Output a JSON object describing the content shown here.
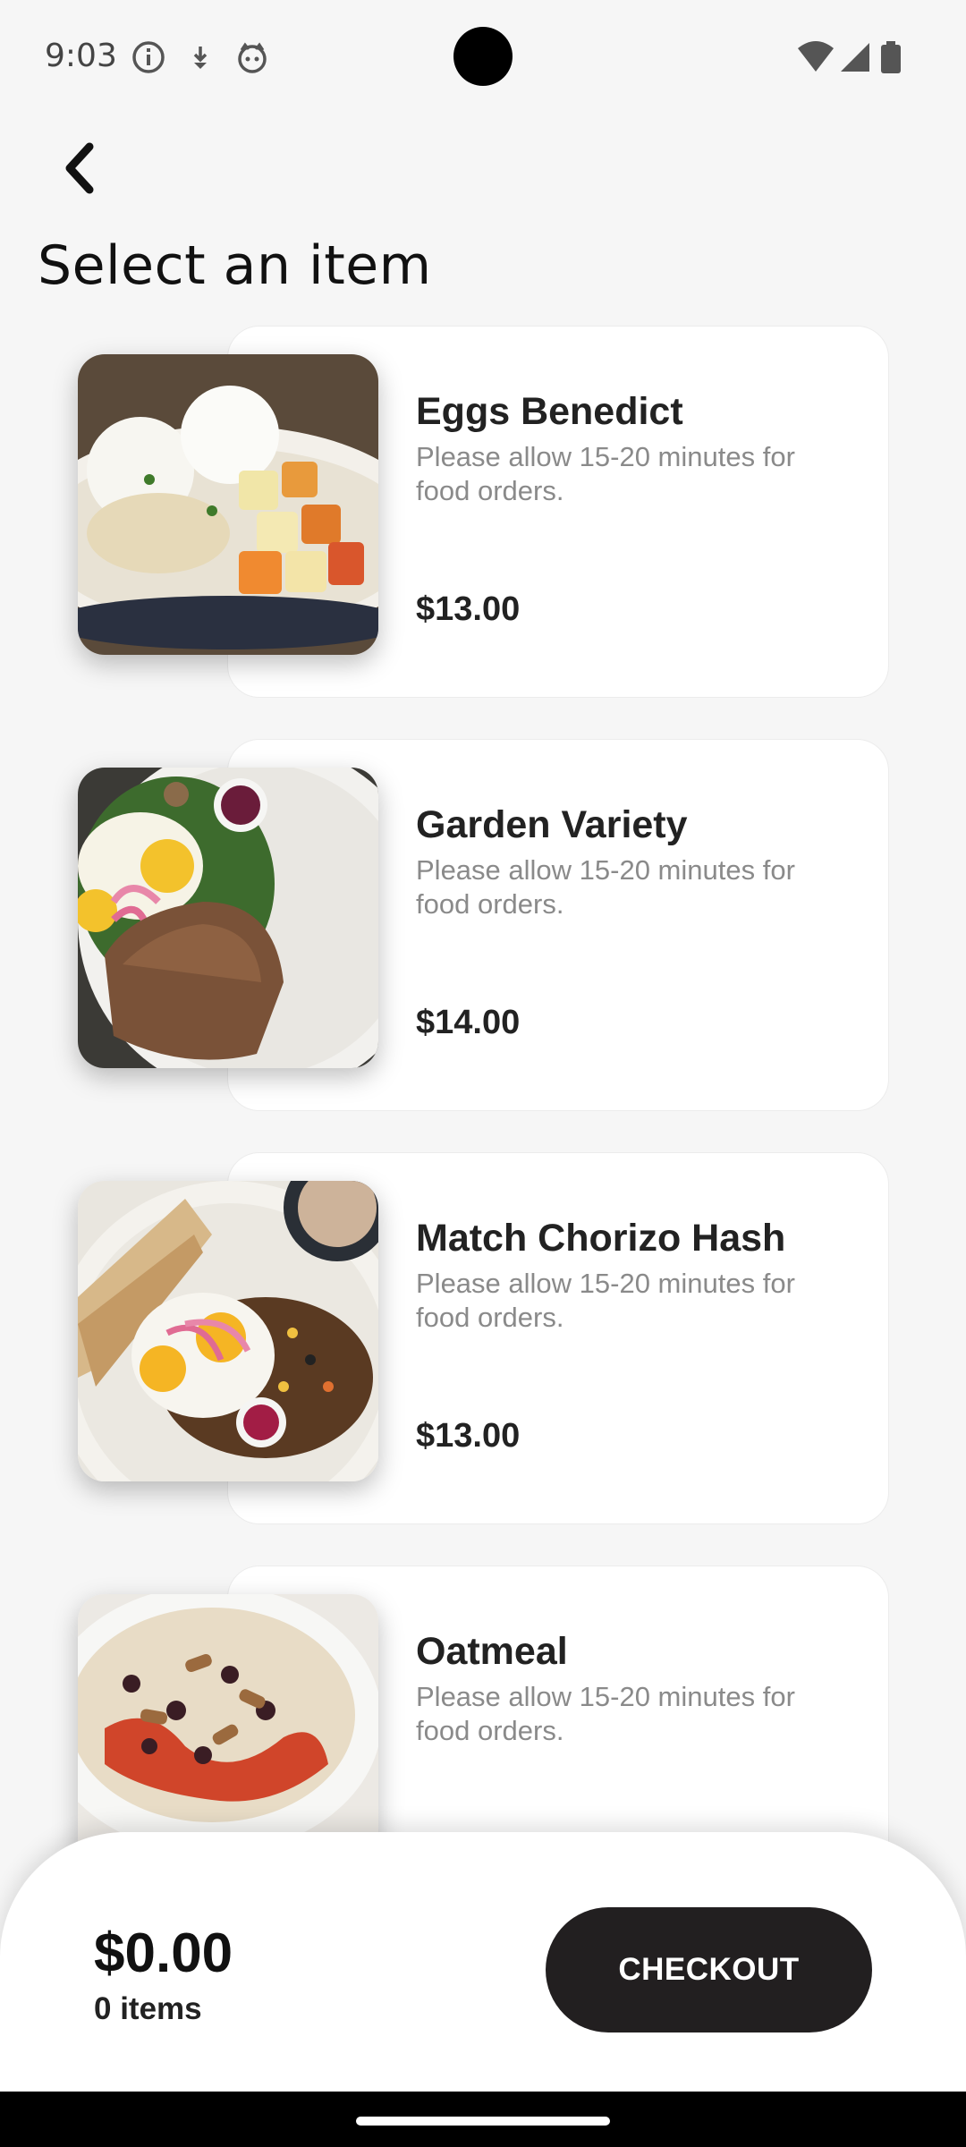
{
  "status_bar": {
    "time": "9:03",
    "left_icons": [
      "info-icon",
      "download-arrow-icon",
      "face-icon"
    ],
    "right_icons": [
      "wifi-icon",
      "signal-icon",
      "battery-icon"
    ]
  },
  "header": {
    "back_icon": "chevron-left-icon",
    "title": "Select an item"
  },
  "items": [
    {
      "name": "Eggs Benedict",
      "description": "Please allow 15-20 minutes for food orders.",
      "price": "$13.00"
    },
    {
      "name": "Garden Variety",
      "description": "Please allow 15-20 minutes for food orders.",
      "price": "$14.00"
    },
    {
      "name": "Match Chorizo Hash",
      "description": "Please allow 15-20 minutes for food orders.",
      "price": "$13.00"
    },
    {
      "name": "Oatmeal",
      "description": "Please allow 15-20 minutes for food orders.",
      "price": ""
    }
  ],
  "cart": {
    "total": "$0.00",
    "items_count": "0 items",
    "checkout_label": "CHECKOUT"
  },
  "colors": {
    "background": "#f6f6f6",
    "button": "#221f20",
    "secondary_text": "#8a8a8a"
  }
}
